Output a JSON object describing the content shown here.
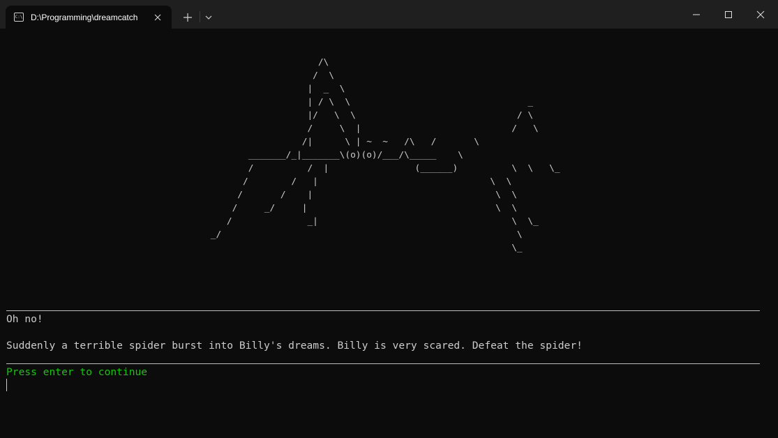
{
  "window": {
    "tab_title": "D:\\Programming\\dreamcatch",
    "tab_icon_text": "C:\\",
    "icons": {
      "tab_icon": "terminal-icon",
      "tab_close": "close-icon",
      "new_tab": "plus-icon",
      "dropdown": "chevron-down-icon",
      "minimize": "minimize-icon",
      "maximize": "maximize-icon",
      "close": "close-icon"
    },
    "colors": {
      "titlebar": "#1f1f1f",
      "terminal_bg": "#0c0c0c",
      "text": "#cccccc",
      "prompt": "#16c60c"
    }
  },
  "terminal": {
    "ascii_art": "                                                          /\\\n                                                         /  \\\n                                                        |  _  \\\n                                                        | / \\  \\                                 _\n                                                        |/   \\  \\                              / \\\n                                                        /     \\  |                            /   \\\n                                                       /|      \\ | ~  ~   /\\   /       \\\n                                             _______/_|_______\\(o)(o)/___/\\_____    \\\n                                             /          /  |                (______)          \\  \\   \\_\n                                            /        /   |                                \\  \\\n                                           /       /    |                                  \\  \\\n                                          /     _/     |                                   \\  \\\n                                         /              _|                                    \\  \\_\n                                      _/                                                       \\\n                                                                                              \\_",
    "lines": [
      "Oh no!",
      "",
      "Suddenly a terrible spider burst into Billy's dreams. Billy is very scared. Defeat the spider!"
    ],
    "prompt": "Press enter to continue"
  }
}
